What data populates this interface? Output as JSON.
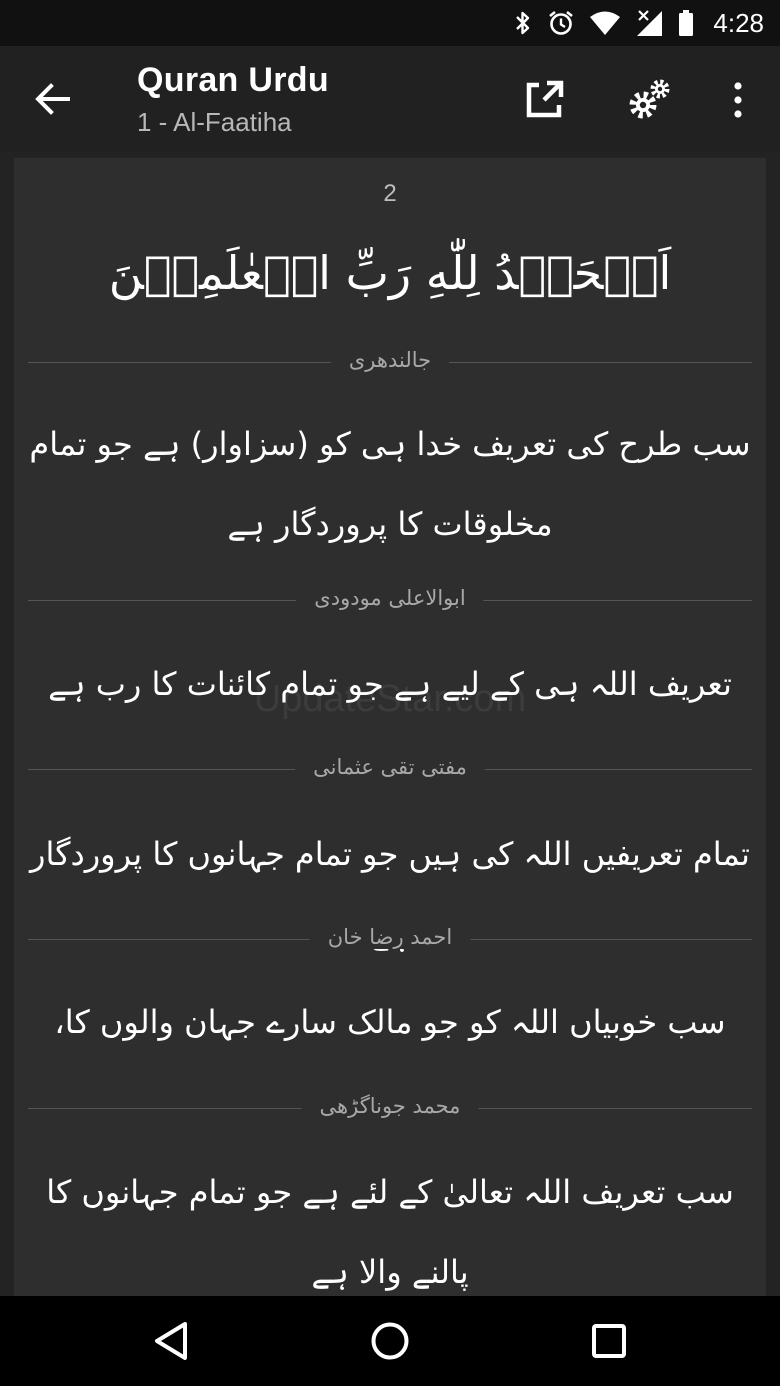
{
  "status_bar": {
    "time": "4:28",
    "icons": [
      "bluetooth-icon",
      "alarm-icon",
      "wifi-icon",
      "cell-signal-icon",
      "battery-icon"
    ]
  },
  "app_bar": {
    "title": "Quran Urdu",
    "subtitle": "1 - Al-Faatiha",
    "icons": [
      "back-arrow-icon",
      "share-external-icon",
      "settings-gears-icon",
      "more-vert-icon"
    ]
  },
  "verse": {
    "number": "2",
    "arabic": "اَلۡحَمۡدُ لِلّٰهِ رَبِّ الۡعٰلَمِيۡنَ"
  },
  "translations": [
    {
      "translator": "جالندھری",
      "text": "سب طرح کی تعریف خدا ہی کو (سزاوار) ہے جو تمام مخلوقات کا پروردگار ہے"
    },
    {
      "translator": "ابوالاعلی مودودی",
      "text": "تعریف اللہ ہی کے لیے ہے جو تمام کائنات کا رب ہے"
    },
    {
      "translator": "مفتی تقی عثمانی",
      "text": "تمام تعریفیں اللہ کی ہیں جو تمام جہانوں کا پروردگار ہے"
    },
    {
      "translator": "احمد رضا خان",
      "text": "سب خوبیاں اللہ کو جو مالک سارے جہان والوں کا،"
    },
    {
      "translator": "محمد جوناگڑھی",
      "text": "سب تعریف اللہ تعالیٰ کے لئے ہے جو تمام جہانوں کا پالنے والا ہے"
    }
  ],
  "watermark": "UpdateStar.com",
  "nav_bar": {
    "icons": [
      "nav-back-icon",
      "nav-home-icon",
      "nav-recents-icon"
    ]
  },
  "colors": {
    "status_bar": "#111111",
    "app_bar": "#212121",
    "card": "#2e2e2e",
    "background": "#232323",
    "nav_bar": "#000000"
  }
}
